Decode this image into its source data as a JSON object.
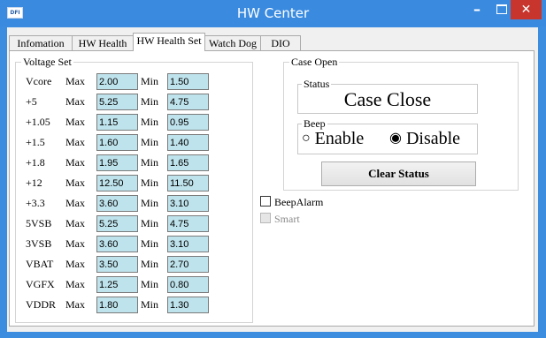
{
  "window": {
    "title": "HW Center",
    "app_icon_text": "DFI",
    "minimize_glyph": "–",
    "close_glyph": "✕"
  },
  "tabs": [
    {
      "label": "Infomation",
      "active": false
    },
    {
      "label": "HW Health",
      "active": false
    },
    {
      "label": "HW Health Set",
      "active": true
    },
    {
      "label": "Watch Dog",
      "active": false
    },
    {
      "label": "DIO",
      "active": false
    }
  ],
  "voltage_set": {
    "legend": "Voltage Set",
    "max_label": "Max",
    "min_label": "Min",
    "rows": [
      {
        "name": "Vcore",
        "max": "2.00",
        "min": "1.50"
      },
      {
        "name": "+5",
        "max": "5.25",
        "min": "4.75"
      },
      {
        "name": "+1.05",
        "max": "1.15",
        "min": "0.95"
      },
      {
        "name": "+1.5",
        "max": "1.60",
        "min": "1.40"
      },
      {
        "name": "+1.8",
        "max": "1.95",
        "min": "1.65"
      },
      {
        "name": "+12",
        "max": "12.50",
        "min": "11.50"
      },
      {
        "name": "+3.3",
        "max": "3.60",
        "min": "3.10"
      },
      {
        "name": "5VSB",
        "max": "5.25",
        "min": "4.75"
      },
      {
        "name": "3VSB",
        "max": "3.60",
        "min": "3.10"
      },
      {
        "name": "VBAT",
        "max": "3.50",
        "min": "2.70"
      },
      {
        "name": "VGFX",
        "max": "1.25",
        "min": "0.80"
      },
      {
        "name": "VDDR",
        "max": "1.80",
        "min": "1.30"
      }
    ]
  },
  "case_open": {
    "legend": "Case Open",
    "status_legend": "Status",
    "status_value": "Case Close",
    "beep_legend": "Beep",
    "enable_label": "Enable",
    "disable_label": "Disable",
    "selected": "Disable",
    "radio_off_glyph": "○",
    "radio_on_glyph": "◉",
    "clear_button": "Clear Status"
  },
  "beep_alarm": {
    "label": "BeepAlarm",
    "checked": false
  },
  "smart": {
    "label": "Smart",
    "checked": false,
    "disabled": true
  },
  "colors": {
    "titlebar": "#3a8be0",
    "close_button": "#c7352d",
    "input_fill": "#bfe3ec"
  }
}
